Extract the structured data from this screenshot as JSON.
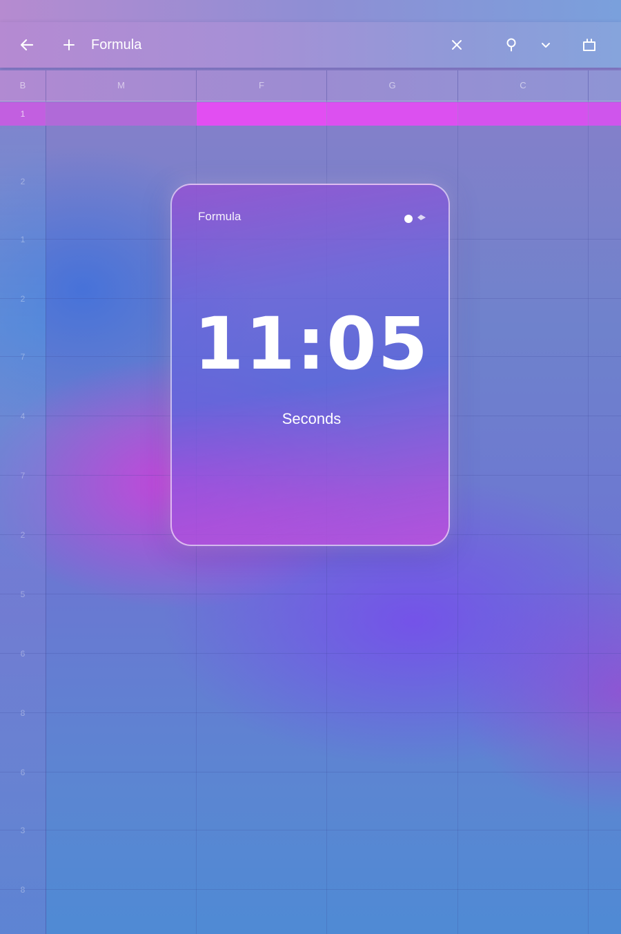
{
  "toolbar": {
    "title": "Formula",
    "icons": [
      "back-arrow-icon",
      "plus-icon",
      "close-icon",
      "location-pin-icon",
      "chevron-down-icon",
      "share-icon"
    ]
  },
  "sheet": {
    "corner_label": "B",
    "columns": [
      "M",
      "F",
      "G",
      "C"
    ],
    "row_one_label": "1",
    "row_numbers": [
      "2",
      "1",
      "2",
      "7",
      "4",
      "7",
      "2",
      "5",
      "6",
      "8",
      "6",
      "3",
      "8"
    ],
    "highlight_color": "#e24ef2"
  },
  "widget": {
    "title": "Formula",
    "time": "11:05",
    "unit_label": "Seconds"
  }
}
